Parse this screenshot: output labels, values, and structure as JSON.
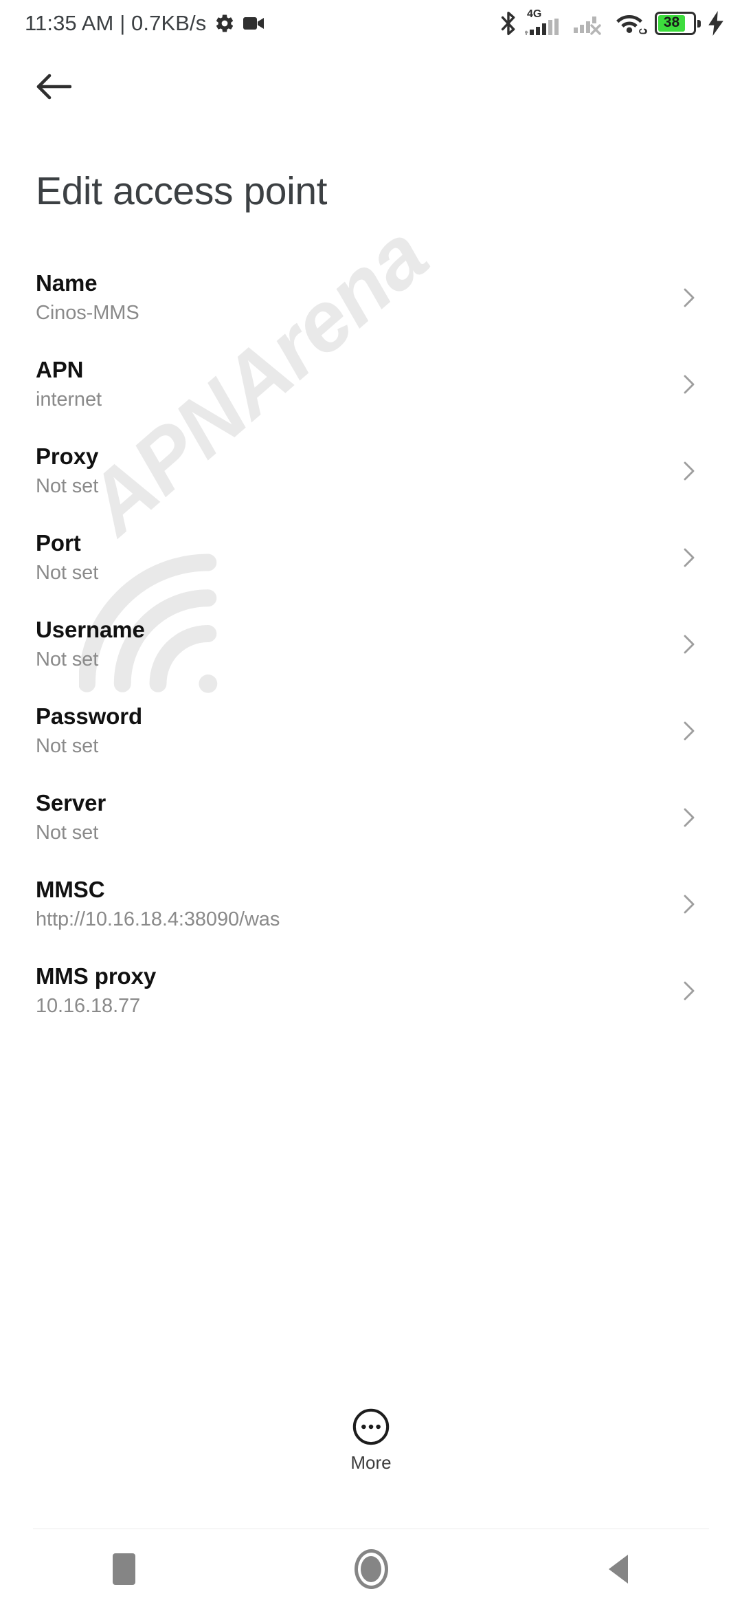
{
  "statusbar": {
    "clock": "11:35 AM | 0.7KB/s",
    "icons_left": [
      "gear-icon",
      "video-camera-icon"
    ],
    "icons_right": [
      "bluetooth-icon",
      "signal-4g-icon",
      "signal-sim2-no-service-icon",
      "wifi-icon",
      "battery-icon",
      "charging-bolt-icon"
    ],
    "network_type": "4G",
    "battery_level": "38",
    "battery_color": "#3ddc3d"
  },
  "appbar": {
    "back_icon": "arrow-left-icon",
    "title": "Edit access point"
  },
  "watermark": {
    "text": "APNArena",
    "color": "#e9e9e9"
  },
  "list": {
    "chevron_icon": "chevron-right-icon",
    "rows": [
      {
        "label": "Name",
        "value": "Cinos-MMS"
      },
      {
        "label": "APN",
        "value": "internet"
      },
      {
        "label": "Proxy",
        "value": "Not set"
      },
      {
        "label": "Port",
        "value": "Not set"
      },
      {
        "label": "Username",
        "value": "Not set"
      },
      {
        "label": "Password",
        "value": "Not set"
      },
      {
        "label": "Server",
        "value": "Not set"
      },
      {
        "label": "MMSC",
        "value": "http://10.16.18.4:38090/was"
      },
      {
        "label": "MMS proxy",
        "value": "10.16.18.77"
      }
    ]
  },
  "more": {
    "label": "More",
    "icon": "more-dots-circle-icon"
  },
  "navbar": {
    "recents": "recents-square-icon",
    "home": "home-circle-icon",
    "back": "back-triangle-icon"
  }
}
